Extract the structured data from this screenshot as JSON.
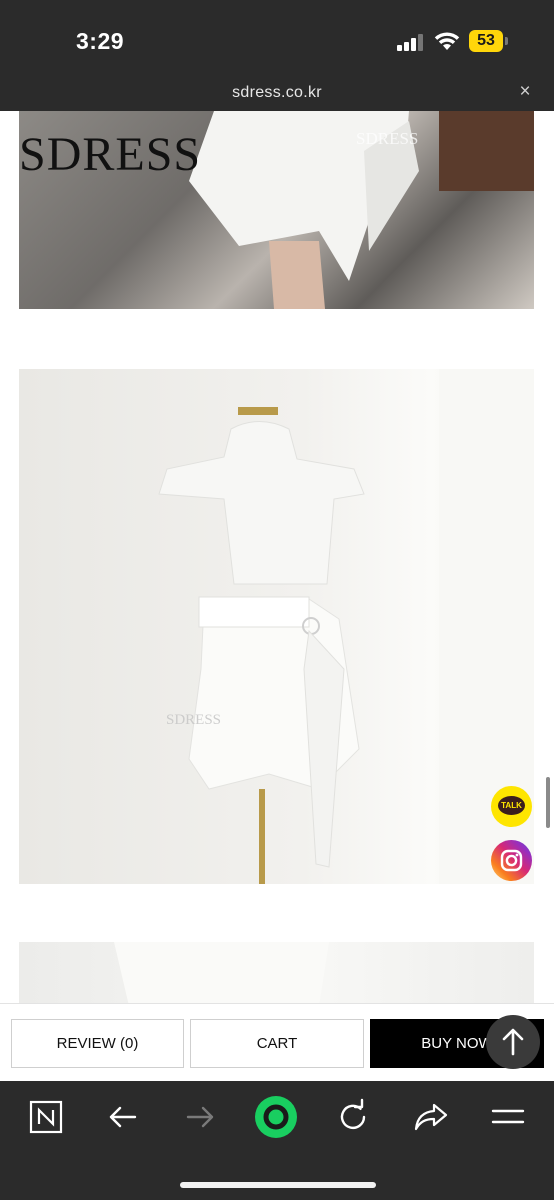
{
  "status_bar": {
    "time": "3:29",
    "battery": "53"
  },
  "browser": {
    "url": "sdress.co.kr"
  },
  "product_images": {
    "brand_logo": "SDRESS",
    "watermark_1": "SDRESS",
    "watermark_2": "SDRESS"
  },
  "floating": {
    "talk_label": "TALK"
  },
  "action_bar": {
    "review_label": "REVIEW (0)",
    "cart_label": "CART",
    "buy_label": "BUY NOW"
  },
  "toolbar_icons": [
    "naver-n-icon",
    "back-arrow-icon",
    "forward-arrow-icon",
    "green-dot-icon",
    "reload-icon",
    "share-icon",
    "menu-icon"
  ],
  "colors": {
    "buy_bg": "#000000",
    "talk_yellow": "#fee500",
    "green_button": "#19ce60"
  }
}
